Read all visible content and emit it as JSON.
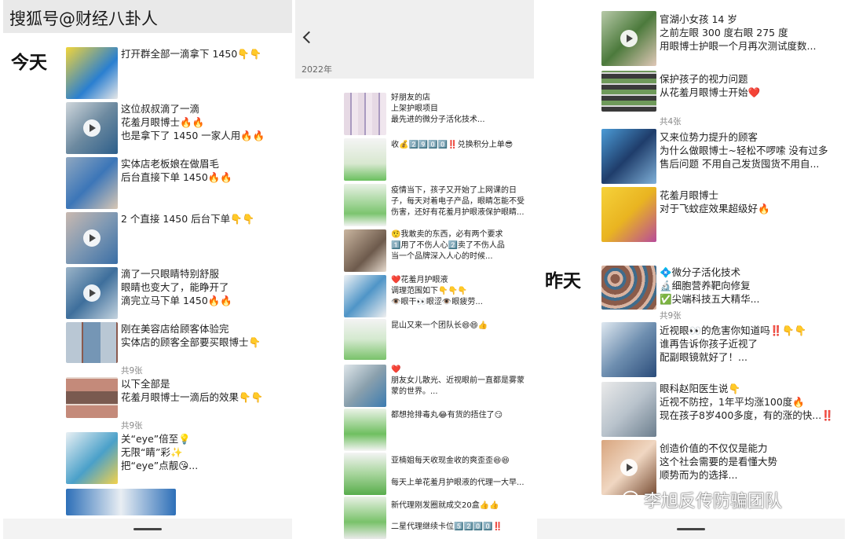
{
  "watermark_top": "搜狐号@财经八卦人",
  "watermark_bottom": "李旭反传防骗团队",
  "left": {
    "day": "今天",
    "posts": [
      {
        "lines": [
          "打开群全部一滴拿下 1450👇👇"
        ]
      },
      {
        "lines": [
          "这位叔叔滴了一滴",
          "花羞月眼博士🔥🔥",
          "也是拿下了 1450 一家人用🔥🔥"
        ]
      },
      {
        "lines": [
          "实体店老板娘在做眉毛",
          "后台直接下单 1450🔥🔥"
        ]
      },
      {
        "lines": [
          "2 个直接 1450 后台下单👇👇"
        ]
      },
      {
        "lines": [
          "滴了一只眼睛特别舒服",
          "眼睛也变大了，能睁开了",
          "滴完立马下单 1450🔥🔥"
        ]
      },
      {
        "lines": [
          "刚在美容店给顾客体验完",
          "实体店的顾客全部要买眼博士👇"
        ]
      },
      {
        "lines": [
          "以下全部是",
          "花羞月眼博士一滴后的效果👇👇"
        ]
      },
      {
        "lines": [
          "关“eye”倍至💡",
          "无限“睛”彩✨",
          "把“eye”点靓😘..."
        ]
      }
    ],
    "counts": [
      "共9张",
      "共9张"
    ]
  },
  "middle": {
    "year": "2022年",
    "posts": [
      {
        "lines": [
          "好朋友的店",
          "上架护眼项目",
          "最先进的微分子活化技术..."
        ]
      },
      {
        "lines": [
          "收💰2️⃣9️⃣0️⃣0️⃣‼️兑换积分上单😎"
        ]
      },
      {
        "lines": [
          "疫情当下，孩子又开始了上网课的日",
          "子，每天对着电子产品，眼睛怎能不受",
          "伤害，还好有花羞月护眼液保护眼睛..."
        ]
      },
      {
        "lines": [
          "🤨我敢卖的东西，必有两个要求",
          "1️⃣用了不伤人心2️⃣卖了不伤人品",
          "当一个品牌深入人心的时候..."
        ]
      },
      {
        "lines": [
          "❤️花羞月护眼液",
          "调理范围如下👇👇👇",
          "👁️眼干👀眼涩👁️眼疲劳..."
        ]
      },
      {
        "lines": [
          "昆山又来一个团队长😄😄👍"
        ]
      },
      {
        "lines": [
          "❤️",
          "朋友女儿散光、近视眼前一直都是雾蒙",
          "蒙的世界。..."
        ]
      },
      {
        "lines": [
          "都想抢排毒丸😂有货的捂住了😏"
        ]
      },
      {
        "lines": [
          "亚楠姐每天收现金收的爽歪歪😆😆"
        ]
      },
      {
        "lines": [
          "每天上单花羞月护眼液的代理一大早..."
        ]
      },
      {
        "lines": [
          "新代理刚发圈就成交20盒👍👍"
        ]
      },
      {
        "lines": [
          "二星代理继续卡位5️⃣2️⃣0️⃣0️⃣‼️"
        ]
      }
    ]
  },
  "right": {
    "day": "昨天",
    "posts": [
      {
        "lines": [
          "官湖小女孩 14 岁",
          "之前左眼 300 度右眼 275 度",
          "用眼博士护眼一个月再次测试度数..."
        ]
      },
      {
        "lines": [
          "保护孩子的视力问题",
          "从花羞月眼博士开始❤️"
        ]
      },
      {
        "lines": [
          "又来位势力提升的顾客",
          "为什么做眼博士~轻松不啰嗦 没有过多",
          "售后问题  不用自己发货囤货不用自..."
        ]
      },
      {
        "lines": [
          "花羞月眼博士",
          "对于飞蚊症效果超级好🔥"
        ]
      },
      {
        "lines": [
          "💠微分子活化技术",
          "🔬细胞营养靶向修复",
          "✅尖端科技五大精华..."
        ]
      },
      {
        "lines": [
          "近视眼👀的危害你知道吗‼️👇👇",
          "谁再告诉你孩子近视了",
          "配副眼镜就好了！..."
        ]
      },
      {
        "lines": [
          "眼科赵阳医生说👇",
          "近视不防控，1年平均涨100度🔥",
          "现在孩子8岁400多度，有的涨的快...‼️"
        ]
      },
      {
        "lines": [
          "创造价值的不仅仅是能力",
          "这个社会需要的是看懂大势",
          "顺势而为的选择..."
        ]
      }
    ],
    "counts": [
      "共4张",
      "共9张"
    ]
  }
}
